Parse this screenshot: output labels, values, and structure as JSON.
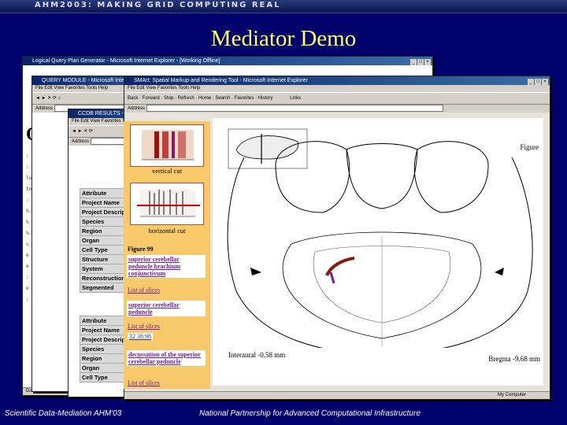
{
  "header": {
    "banner": "AHM2003: MAKING GRID COMPUTING REAL"
  },
  "slide": {
    "title": "Mediator Demo"
  },
  "footer": {
    "left": "Scientific Data-Mediation AHM'03",
    "right": "National Partnership for Advanced Computational Infrastructure"
  },
  "windows": {
    "back": {
      "title": "Logical Query Plan Generator - Microsoft Internet Explorer - [Working Offline]",
      "heading": "QU",
      "status": "Done"
    },
    "query": {
      "title": "QUERY MODULE - Microsoft Internet Explorer",
      "menu": "File  Edit  View  Favorites  Tools  Help",
      "address_label": "Address"
    },
    "results": {
      "title": "CCDB RESULTS - Microsoft Internet Explorer",
      "menu": "File  Edit  View  Favorites  Tools  Help",
      "address_label": "Address"
    },
    "smart": {
      "title": "SMArt: Spatial Markup and Rendering Tool - Microsoft Internet Explorer",
      "menu": "File  Edit  View  Favorites  Tools  Help",
      "toolbar": "Back  ·  Forward  ·  Stop  ·  Refresh  ·  Home  ·  Search  ·  Favorites  ·  History",
      "links": "Links",
      "address_label": "Address",
      "status_right": "My Computer"
    }
  },
  "attributes_top": [
    "Attribute",
    "Project Name",
    "Project Description",
    "Species",
    "Region",
    "Organ",
    "Cell Type",
    "Structure",
    "System",
    "Reconstruction",
    "Segmented"
  ],
  "attributes_bottom": [
    "Attribute",
    "Project Name",
    "Project Description",
    "Species",
    "Region",
    "Organ",
    "Cell Type"
  ],
  "sidebar": {
    "vertical_cut": "vertical cut",
    "horizontal_cut": "horizontal cut",
    "figure": "Figure 99",
    "link1": "superior cerebellar peduncle brachium conjunctivum",
    "list1": "List of slices",
    "link2": "superior cerebellar peduncle",
    "list2": "List of slices",
    "slices": "32 38 98",
    "link3": "decussation of the superior cerebellar peduncle",
    "list3": "List of slices"
  },
  "atlas": {
    "figure_label": "Figure",
    "interaural": "Interaural -0.58 mm",
    "bregma": "Bregma -9.68 mm"
  },
  "colors": {
    "background": "#00006b",
    "title": "#ffff66",
    "panel": "#f7c96b",
    "link": "#7a1aa0",
    "highlight": "#8a1a10"
  }
}
